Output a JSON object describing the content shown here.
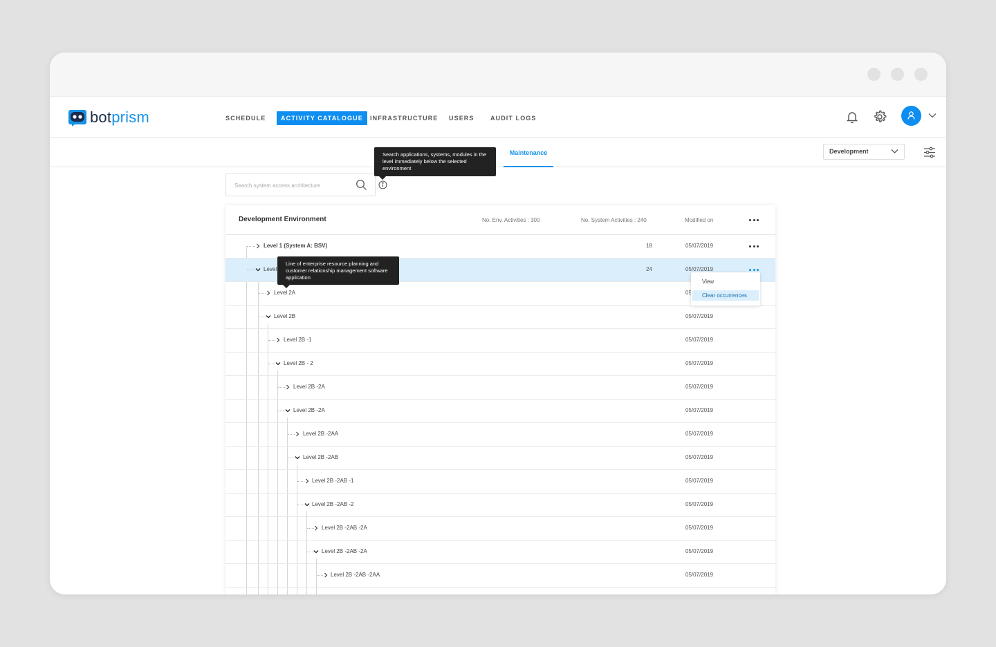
{
  "brand": {
    "part1": "bot",
    "part2": "prism"
  },
  "nav": {
    "items": [
      {
        "label": "SCHEDULE",
        "active": false
      },
      {
        "label": "ACTIVITY CATALOGUE",
        "active": true
      },
      {
        "label": "INFRASTRUCTURE",
        "active": false
      },
      {
        "label": "USERS",
        "active": false
      },
      {
        "label": "AUDIT LOGS",
        "active": false
      }
    ]
  },
  "subnav": {
    "tab": "Maintenance",
    "env_select": "Development"
  },
  "search": {
    "placeholder": "Search system access architecture",
    "tooltip": "Search applications, systems, modules in the level immediately below the selected environment"
  },
  "row_tooltip": "Line of enterprise resource planning and customer relationship management software application",
  "table": {
    "title": "Development Environment",
    "env_activities": "No. Env. Activities : 300",
    "system_activities": "No. System Activities : 240",
    "modified": "Modified on",
    "rows": [
      {
        "label": "Level 1 (System A: BSV)",
        "count": "18",
        "date": "05/07/2019",
        "expanded": false
      },
      {
        "label": "Level",
        "count": "24",
        "date": "05/07/2019",
        "expanded": true
      },
      {
        "label": "Level 2A",
        "count": "",
        "date": "05",
        "expanded": false
      },
      {
        "label": "Level 2B",
        "count": "",
        "date": "05/07/2019",
        "expanded": true
      },
      {
        "label": "Level 2B -1",
        "count": "",
        "date": "05/07/2019",
        "expanded": false
      },
      {
        "label": "Level 2B - 2",
        "count": "",
        "date": "05/07/2019",
        "expanded": true
      },
      {
        "label": "Level 2B -2A",
        "count": "",
        "date": "05/07/2019",
        "expanded": false
      },
      {
        "label": "Level 2B -2A",
        "count": "",
        "date": "05/07/2019",
        "expanded": true
      },
      {
        "label": "Level 2B -2AA",
        "count": "",
        "date": "05/07/2019",
        "expanded": false
      },
      {
        "label": "Level 2B -2AB",
        "count": "",
        "date": "05/07/2019",
        "expanded": true
      },
      {
        "label": "Level 2B -2AB -1",
        "count": "",
        "date": "05/07/2019",
        "expanded": false
      },
      {
        "label": "Level 2B -2AB -2",
        "count": "",
        "date": "05/07/2019",
        "expanded": true
      },
      {
        "label": "Level 2B -2AB -2A",
        "count": "",
        "date": "05/07/2019",
        "expanded": false
      },
      {
        "label": "Level 2B -2AB -2A",
        "count": "",
        "date": "05/07/2019",
        "expanded": true
      },
      {
        "label": "Level 2B -2AB -2AA",
        "count": "",
        "date": "05/07/2019",
        "expanded": false
      }
    ]
  },
  "context_menu": {
    "view": "View",
    "clear": "Clear occurrences"
  },
  "colors": {
    "accent": "#0d8ef0",
    "selected_row": "#daeefc",
    "tooltip_bg": "#222222"
  },
  "icons": [
    "bell-icon",
    "gear-icon",
    "user-icon",
    "chevron-down-icon",
    "filter-icon",
    "search-icon",
    "info-icon",
    "more-icon",
    "chevron-right-icon"
  ]
}
